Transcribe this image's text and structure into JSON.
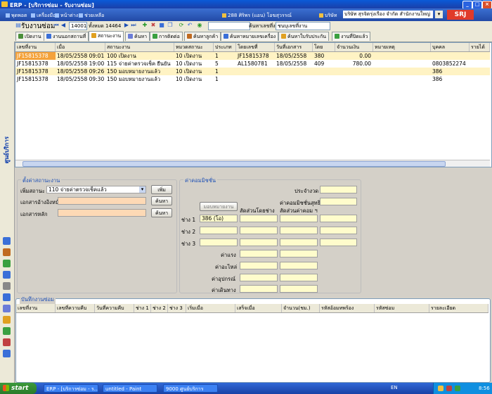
{
  "window": {
    "title": "ERP - [บริการซ่อม - รับงานซ่อม]"
  },
  "menu": {
    "items": [
      "พุดพอต",
      "เครื่องมือ",
      "หน้าต่าง",
      "ช่วยเหลือ"
    ],
    "user": "288 ศิริพร (แอน) โอฆสุวรรณ์",
    "company_label": "บริษัท",
    "company": "บริษัท สุรจิตรุ่งเรือง จำกัด สำนักงานใหญ่",
    "logo": "SRJ"
  },
  "toolbar": {
    "module_title": "รับงานซ่อม",
    "record_no": "14001",
    "record_total": "ทั้งหมด 14464",
    "search_label": "ค้นหาเลขที่งาน",
    "search_hint": "ชนบุเลขที่งาน"
  },
  "tabs": [
    {
      "label": "เปิดงาน",
      "color": "#4a8f3a"
    },
    {
      "label": "งานนอกสถานที่",
      "color": "#3a6fd8"
    },
    {
      "label": "สถานะงาน",
      "color": "#e0a020",
      "active": true
    },
    {
      "label": "ค้นหา",
      "color": "#6a7cd8"
    },
    {
      "label": "การติดต่อ",
      "color": "#3aa040"
    },
    {
      "label": "ค้นหาลูกค้า",
      "color": "#c06a20"
    },
    {
      "label": "ค้นหาหมายเลขเครื่อง",
      "color": "#3a6fd8"
    },
    {
      "label": "ค้นหาใบรับประกัน",
      "color": "#e0a020"
    },
    {
      "label": "งานที่ปิดแล้ว",
      "color": "#3aa040"
    }
  ],
  "sidebar": {
    "title": "ศูนย์บริการ"
  },
  "grid": {
    "columns": [
      "เลขที่งาน",
      "เมื่อ",
      "สถานะงาน",
      "หมวดสถานะ",
      "ประเภท",
      "โดยเลขที่",
      "วันที่เอกสาร",
      "โดย",
      "จำนวนเงิน",
      "หมายเหตุ",
      "บุคคล",
      "รายได้"
    ],
    "rows": [
      {
        "job": "JF15815378",
        "when": "18/05/2558 09:01",
        "status": "100 เปิดงาน",
        "category": "10 เปิดงาน",
        "type": "1",
        "ref": "JF15815378",
        "doc_date": "18/05/2558",
        "by": "380",
        "amount": "0.00",
        "note": "",
        "person": "",
        "income": "",
        "selected": true
      },
      {
        "job": "JF15815378",
        "when": "18/05/2558 19:00",
        "status": "115 จ่ายค่าตรวจเช็ค ยืนยัน",
        "category": "10 เปิดงาน",
        "type": "5",
        "ref": "AL1580781",
        "doc_date": "18/05/2558",
        "by": "409",
        "amount": "780.00",
        "note": "",
        "person": "0803852274",
        "income": ""
      },
      {
        "job": "JF15815378",
        "when": "18/05/2558 09:26",
        "status": "150 มอบหมายงานแล้ว",
        "category": "10 เปิดงาน",
        "type": "1",
        "ref": "",
        "doc_date": "",
        "by": "",
        "amount": "",
        "note": "",
        "person": "386",
        "income": ""
      },
      {
        "job": "JF15815378",
        "when": "18/05/2558 09:30",
        "status": "150 มอบหมายงานแล้ว",
        "category": "10 เปิดงาน",
        "type": "1",
        "ref": "",
        "doc_date": "",
        "by": "",
        "amount": "",
        "note": "",
        "person": "386",
        "income": ""
      }
    ]
  },
  "status_panel": {
    "title": "ตั้งค่าสถานะงาน",
    "add_status_label": "เพิ่มสถานะ",
    "add_status_value": "110 จ่ายค่าตรวจเช็คแล้ว",
    "add_button": "เพิ่ม",
    "ref_doc_label": "เอกสารอ้างอิงหน้า",
    "ref_doc_value": "",
    "main_doc_label": "เอกสารหลัก",
    "main_doc_value": "",
    "search_button": "ค้นหา"
  },
  "commission_panel": {
    "title": "ค่าคอมมิชชั่น",
    "assign_button": "มอบหมายงาน",
    "col_ratio": "สัดส่วนโดยช่าง",
    "col_comm": "สัดส่วนค่าคอม ฯ",
    "history_label": "ประจำงวด",
    "net_label": "ค่าคอมมิชชั่นสุทธิ",
    "tech_labels": [
      "ช่าง 1",
      "ช่าง 2",
      "ช่าง 3"
    ],
    "tech1_value": "386 (โอ)",
    "fee_labels": [
      "ค่าแรง",
      "ค่าอะไหล่",
      "ค่าอุปกรณ์",
      "ค่าเดินทาง"
    ]
  },
  "log_panel": {
    "title": "บันทึกงานซ่อม",
    "columns": [
      "เลขที่งาน",
      "เลขที่ความคืบ",
      "วันที่ความคืบ",
      "ช่าง 1",
      "ช่าง 2",
      "ช่าง 3",
      "เริ่มเมื่อ",
      "เสร็จเมื่อ",
      "จำนวน(ชม.)",
      "รหัสอ้อมทพร้อง",
      "รหัสซ่อม",
      "รายละเอียด"
    ]
  },
  "taskbar": {
    "start": "start",
    "tasks": [
      "ERP - [บริการซ่อม - ร...",
      "untitled - Paint",
      "9000 ศูนย์บริการ"
    ],
    "lang": "EN",
    "time": "8:56"
  }
}
